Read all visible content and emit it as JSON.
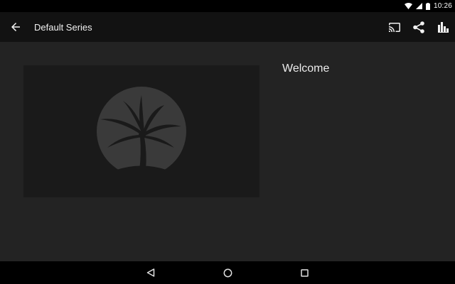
{
  "status_bar": {
    "time": "10:26",
    "icons": [
      "wifi-icon",
      "cell-signal-icon",
      "battery-icon"
    ]
  },
  "app_bar": {
    "title": "Default Series",
    "icons": {
      "back": "arrow-back-icon",
      "cast": "cast-icon",
      "share": "share-icon",
      "stats": "bar-chart-icon"
    }
  },
  "main": {
    "welcome_text": "Welcome",
    "thumbnail_icon": "palm-tree-logo-icon"
  },
  "nav_bar": {
    "icons": [
      "back-triangle-icon",
      "home-circle-icon",
      "recents-square-icon"
    ]
  },
  "colors": {
    "app_bar_bg": "#121212",
    "content_bg": "#232323",
    "card_bg": "#1a1a1a",
    "logo_circle": "#3a3a3a"
  }
}
